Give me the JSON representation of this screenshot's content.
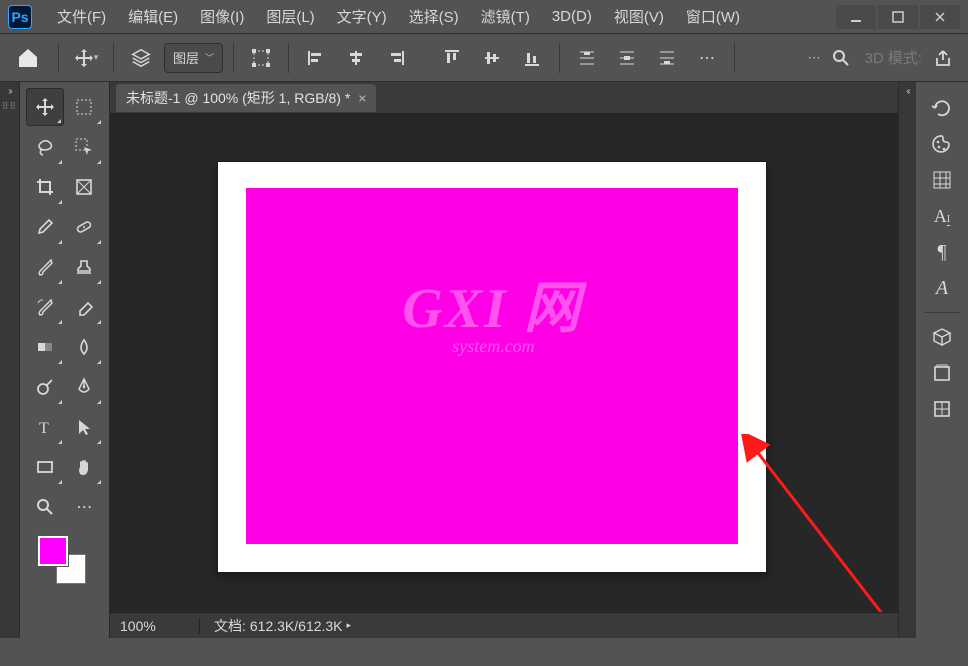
{
  "menubar": {
    "items": [
      "文件(F)",
      "编辑(E)",
      "图像(I)",
      "图层(L)",
      "文字(Y)",
      "选择(S)",
      "滤镜(T)",
      "3D(D)",
      "视图(V)",
      "窗口(W)"
    ]
  },
  "options_bar": {
    "layer_dropdown": "图层",
    "three_d_label": "3D 模式:"
  },
  "document": {
    "tab_title": "未标题-1 @ 100% (矩形 1, RGB/8) *",
    "watermark_big": "GXI 网",
    "watermark_small": "system.com"
  },
  "status": {
    "zoom": "100%",
    "doc_label": "文档:",
    "doc_size": "612.3K/612.3K"
  },
  "colors": {
    "foreground": "#ff00ff",
    "background": "#ffffff",
    "shape_fill": "#ff00e6"
  }
}
